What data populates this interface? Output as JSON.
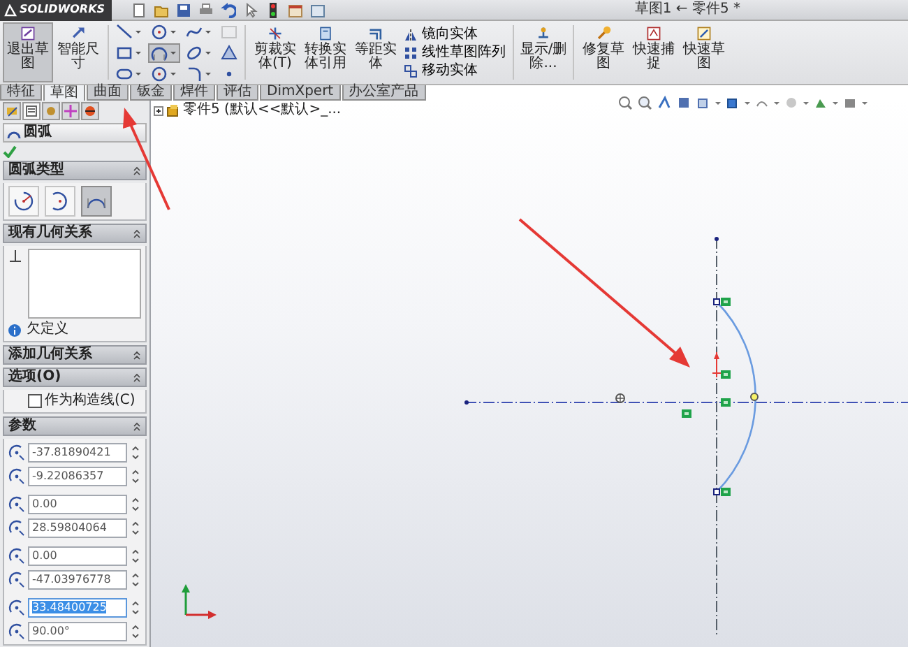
{
  "title_bar": {
    "logo": "SOLIDWORKS",
    "title": "草图1 ← 零件5 *"
  },
  "ribbon": {
    "main_buttons": [
      {
        "kind": "exit_sketch",
        "label": "退出草图",
        "selected": true
      },
      {
        "kind": "smart_dimension",
        "label": "智能尺寸",
        "selected": false
      }
    ],
    "sketch_tools": [
      {
        "kind": "line",
        "selected": false,
        "disabled": false
      },
      {
        "kind": "circle",
        "selected": false,
        "disabled": false
      },
      {
        "kind": "spline",
        "selected": false,
        "disabled": false
      },
      {
        "kind": "text",
        "selected": false,
        "disabled": true
      },
      {
        "kind": "rectangle",
        "selected": false,
        "disabled": false
      },
      {
        "kind": "arc",
        "selected": true,
        "disabled": false
      },
      {
        "kind": "ellipse",
        "selected": false,
        "disabled": false
      },
      {
        "kind": "polygon",
        "selected": false,
        "disabled": false
      },
      {
        "kind": "slot",
        "selected": false,
        "disabled": false
      },
      {
        "kind": "circle",
        "selected": false,
        "disabled": false
      },
      {
        "kind": "fillet",
        "selected": false,
        "disabled": false
      },
      {
        "kind": "point",
        "selected": false,
        "disabled": false
      }
    ],
    "commands": [
      {
        "kind": "trim",
        "label": "剪裁实体(T)"
      },
      {
        "kind": "convert",
        "label": "转换实体引用"
      },
      {
        "kind": "offset",
        "label": "等距实体"
      }
    ],
    "entity_list": [
      {
        "kind": "mirror",
        "label": "镜向实体"
      },
      {
        "kind": "pattern",
        "label": "线性草图阵列"
      },
      {
        "kind": "move",
        "label": "移动实体"
      }
    ],
    "right_buttons": [
      {
        "kind": "relations",
        "label": "显示/删除..."
      },
      {
        "kind": "repair",
        "label": "修复草图"
      },
      {
        "kind": "snaps",
        "label": "快速捕捉"
      },
      {
        "kind": "rapid",
        "label": "快速草图"
      }
    ]
  },
  "command_tabs": [
    {
      "label": "特征",
      "selected": false
    },
    {
      "label": "草图",
      "selected": true
    },
    {
      "label": "曲面",
      "selected": false
    },
    {
      "label": "钣金",
      "selected": false
    },
    {
      "label": "焊件",
      "selected": false
    },
    {
      "label": "评估",
      "selected": false
    },
    {
      "label": "DimXpert",
      "selected": false
    },
    {
      "label": "办公室产品",
      "selected": false
    }
  ],
  "panel": {
    "tabs": [
      {
        "kind": "tree",
        "selected": false
      },
      {
        "kind": "property",
        "selected": true
      },
      {
        "kind": "config",
        "selected": false
      },
      {
        "kind": "dimxpert",
        "selected": false
      },
      {
        "kind": "display",
        "selected": false
      }
    ],
    "title": "圆弧",
    "arc_type": {
      "title": "圆弧类型",
      "types": [
        {
          "kind": "center",
          "selected": false
        },
        {
          "kind": "tangent",
          "selected": false
        },
        {
          "kind": "three_point",
          "selected": true
        }
      ]
    },
    "relations": {
      "title": "现有几何关系",
      "status": "欠定义"
    },
    "add_relations": {
      "title": "添加几何关系"
    },
    "options": {
      "title": "选项(O)",
      "construction": {
        "label": "作为构造线(C)",
        "checked": false
      }
    },
    "parameters": {
      "title": "参数",
      "fields": [
        {
          "value": "-37.81890421",
          "selected": false
        },
        {
          "value": "-9.22086357",
          "selected": false
        },
        {
          "value": "0.00",
          "selected": false
        },
        {
          "value": "28.59804064",
          "selected": false
        },
        {
          "value": "0.00",
          "selected": false
        },
        {
          "value": "-47.03976778",
          "selected": false
        },
        {
          "value": "33.48400725",
          "selected": true
        },
        {
          "value": "90.00°",
          "selected": false
        }
      ]
    }
  },
  "canvas": {
    "tree_label": "零件5 (默认<<默认>_..."
  }
}
